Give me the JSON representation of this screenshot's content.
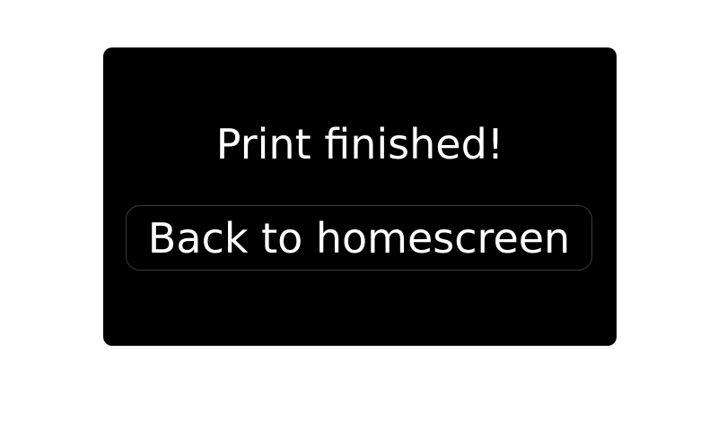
{
  "dialog": {
    "title": "Print finished!",
    "back_button_label": "Back to homescreen"
  },
  "colors": {
    "page_background": "#ffffff",
    "dialog_background": "#000000",
    "text": "#ffffff",
    "button_border": "#3a3a3a"
  }
}
